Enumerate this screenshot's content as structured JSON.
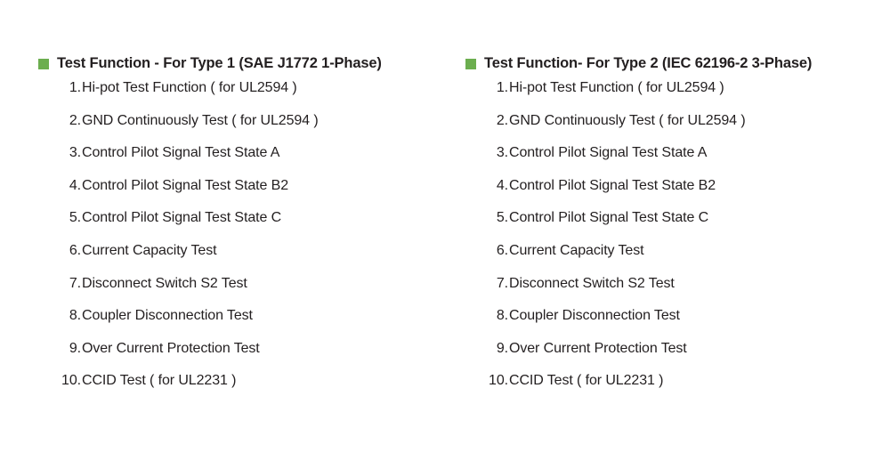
{
  "theme": {
    "background": "#ffffff",
    "text_color": "#231f20",
    "bullet_color": "#6cae4f"
  },
  "columns": [
    {
      "marker": "green-square-bullet",
      "title": "Test Function - For Type 1 (SAE J1772 1-Phase)",
      "items": [
        {
          "number": "1.",
          "label": "Hi-pot Test Function ( for UL2594 )"
        },
        {
          "number": "2.",
          "label": "GND Continuously Test ( for UL2594 )"
        },
        {
          "number": "3.",
          "label": "Control Pilot Signal Test State A"
        },
        {
          "number": "4.",
          "label": "Control Pilot Signal Test State B2"
        },
        {
          "number": "5.",
          "label": "Control Pilot Signal Test State C"
        },
        {
          "number": "6.",
          "label": "Current Capacity Test"
        },
        {
          "number": "7.",
          "label": "Disconnect Switch S2 Test"
        },
        {
          "number": "8.",
          "label": "Coupler Disconnection Test"
        },
        {
          "number": "9.",
          "label": "Over Current Protection Test"
        },
        {
          "number": "10.",
          "label": "CCID Test ( for UL2231 )"
        }
      ]
    },
    {
      "marker": "green-square-bullet",
      "title": "Test Function- For Type 2 (IEC 62196-2 3-Phase)",
      "items": [
        {
          "number": "1.",
          "label": "Hi-pot Test Function ( for UL2594 )"
        },
        {
          "number": "2.",
          "label": "GND Continuously Test ( for UL2594 )"
        },
        {
          "number": "3.",
          "label": "Control Pilot Signal Test State A"
        },
        {
          "number": "4.",
          "label": "Control Pilot Signal Test State B2"
        },
        {
          "number": "5.",
          "label": "Control Pilot Signal Test State C"
        },
        {
          "number": "6.",
          "label": "Current Capacity Test"
        },
        {
          "number": "7.",
          "label": "Disconnect Switch S2 Test"
        },
        {
          "number": "8.",
          "label": "Coupler Disconnection Test"
        },
        {
          "number": "9.",
          "label": "Over Current Protection Test"
        },
        {
          "number": "10.",
          "label": "CCID Test ( for UL2231 )"
        }
      ]
    }
  ]
}
